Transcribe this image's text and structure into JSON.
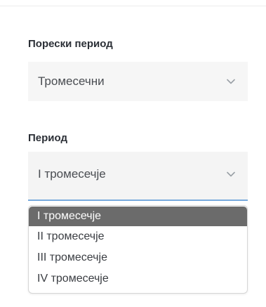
{
  "tax_period": {
    "label": "Порески период",
    "value": "Тромесечни"
  },
  "period": {
    "label": "Период",
    "value": "I тромесечје",
    "options": [
      {
        "label": "I тромесечје",
        "selected": true
      },
      {
        "label": "II тромесечје",
        "selected": false
      },
      {
        "label": "III тромесечје",
        "selected": false
      },
      {
        "label": "IV тромесечје",
        "selected": false
      }
    ]
  },
  "colors": {
    "focus_underline": "#78aadd",
    "selected_option_bg": "#6b6b6b",
    "field_bg": "#f6f6f6"
  },
  "icons": {
    "dropdown": "chevron-down-icon"
  }
}
